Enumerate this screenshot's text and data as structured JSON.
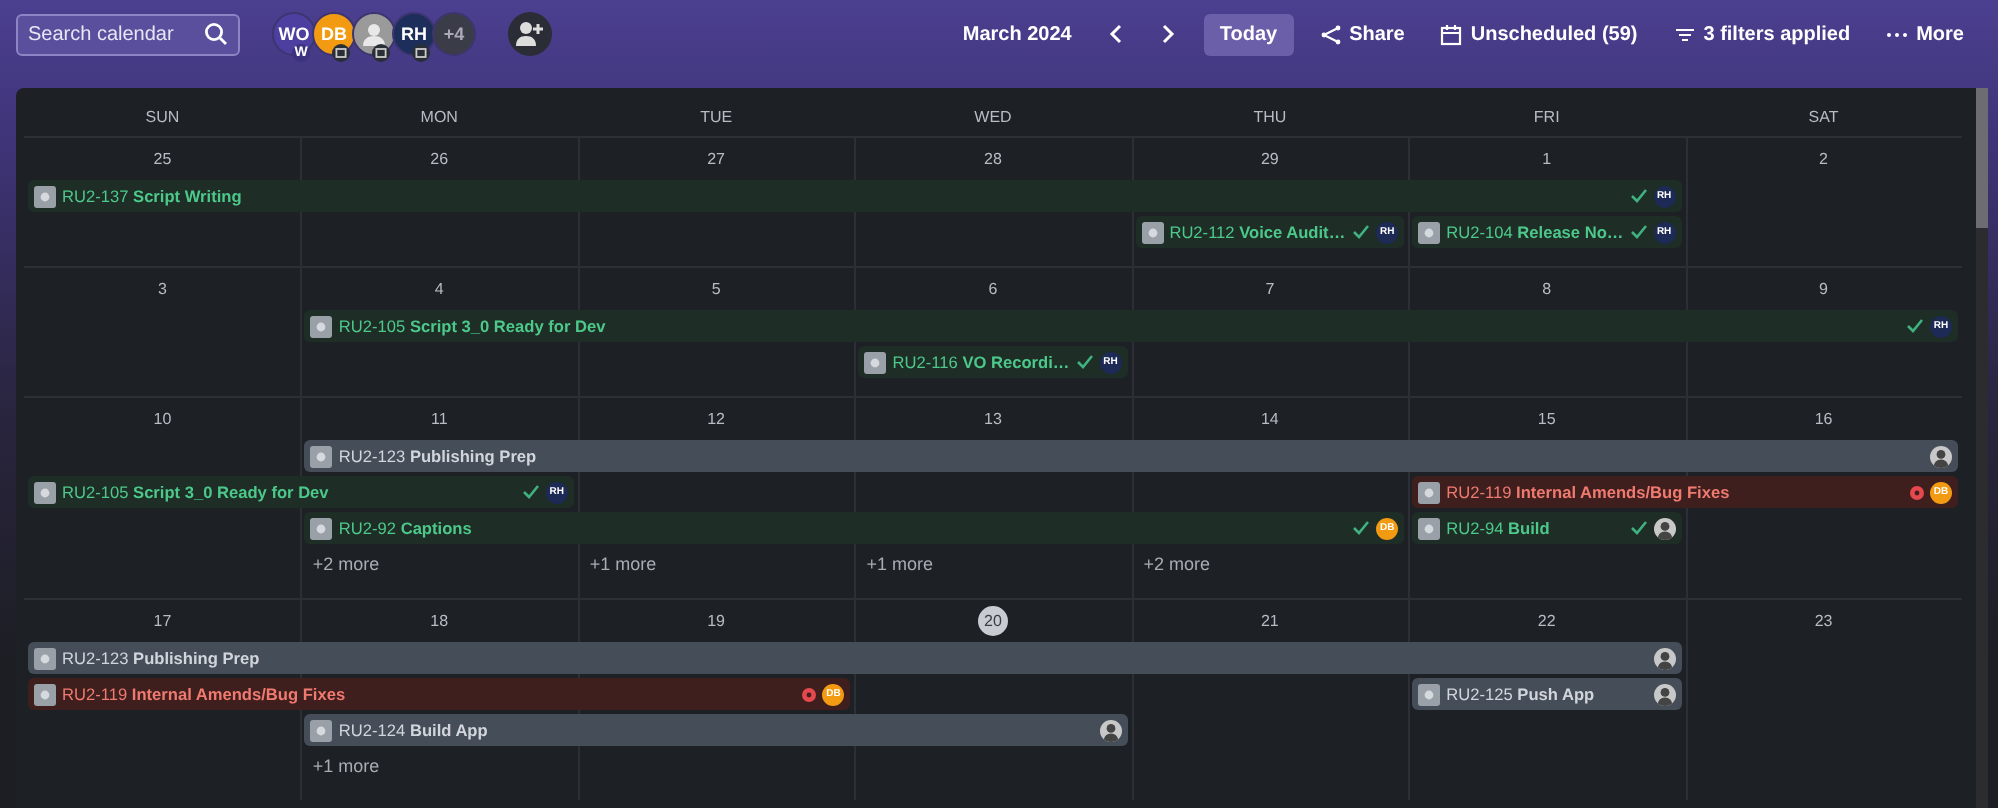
{
  "toolbar": {
    "search": {
      "placeholder": "Search calendar"
    },
    "avatars": [
      {
        "kind": "initials",
        "text": "WO",
        "color": "#4d3fa0",
        "badge": "W",
        "team_badge": false
      },
      {
        "kind": "initials",
        "text": "DB",
        "color": "#f29a12",
        "team_badge": true
      },
      {
        "kind": "photo",
        "team_badge": true
      },
      {
        "kind": "initials",
        "text": "RH",
        "color": "#1e2e5a",
        "team_badge": true
      },
      {
        "kind": "count",
        "text": "+4"
      }
    ],
    "month": "March 2024",
    "today": "Today",
    "share": "Share",
    "unscheduled": "Unscheduled (59)",
    "filters": "3 filters applied",
    "more": "More"
  },
  "weekdays": [
    "SUN",
    "MON",
    "TUE",
    "WED",
    "THU",
    "FRI",
    "SAT"
  ],
  "weeks": [
    {
      "days": [
        {
          "label": "25",
          "today": false
        },
        {
          "label": "26",
          "today": false
        },
        {
          "label": "27",
          "today": false
        },
        {
          "label": "28",
          "today": false
        },
        {
          "label": "29",
          "today": false
        },
        {
          "label": "1",
          "today": false
        },
        {
          "label": "2",
          "today": false
        }
      ],
      "lanes": [
        [
          {
            "kind": "done_event",
            "key": "RU2-137",
            "title": "Script Writing",
            "assignee": {
              "kind": "initials",
              "text": "RH",
              "color": "#1d2a55"
            }
          },
          {
            "kind": "continued"
          },
          {
            "kind": "continued"
          },
          {
            "kind": "continued"
          },
          {
            "kind": "continued"
          },
          {
            "kind": "continued"
          },
          {
            "kind": "empty"
          }
        ],
        [
          {
            "kind": "empty"
          },
          {
            "kind": "empty"
          },
          {
            "kind": "empty"
          },
          {
            "kind": "empty"
          },
          {
            "kind": "done_event",
            "key": "RU2-112",
            "title": "Voice Audit…",
            "assignee": {
              "kind": "initials",
              "text": "RH",
              "color": "#1d2a55"
            }
          },
          {
            "kind": "done_event",
            "key": "RU2-104",
            "title": "Release No…",
            "assignee": {
              "kind": "initials",
              "text": "RH",
              "color": "#1d2a55"
            }
          },
          {
            "kind": "empty"
          }
        ]
      ]
    },
    {
      "days": [
        {
          "label": "3",
          "today": false
        },
        {
          "label": "4",
          "today": false
        },
        {
          "label": "5",
          "today": false
        },
        {
          "label": "6",
          "today": false
        },
        {
          "label": "7",
          "today": false
        },
        {
          "label": "8",
          "today": false
        },
        {
          "label": "9",
          "today": false
        }
      ],
      "lanes": [
        [
          {
            "kind": "empty"
          },
          {
            "kind": "done_event",
            "key": "RU2-105",
            "title": "Script 3_0 Ready for Dev",
            "assignee": {
              "kind": "initials",
              "text": "RH",
              "color": "#1d2a55"
            }
          },
          {
            "kind": "continued"
          },
          {
            "kind": "continued"
          },
          {
            "kind": "continued"
          },
          {
            "kind": "continued"
          },
          {
            "kind": "continued"
          }
        ],
        [
          {
            "kind": "empty"
          },
          {
            "kind": "empty"
          },
          {
            "kind": "empty"
          },
          {
            "kind": "done_event",
            "key": "RU2-116",
            "title": "VO Recordi…",
            "assignee": {
              "kind": "initials",
              "text": "RH",
              "color": "#1d2a55"
            }
          },
          {
            "kind": "empty"
          },
          {
            "kind": "empty"
          },
          {
            "kind": "empty"
          }
        ]
      ]
    },
    {
      "days": [
        {
          "label": "10",
          "today": false
        },
        {
          "label": "11",
          "today": false
        },
        {
          "label": "12",
          "today": false
        },
        {
          "label": "13",
          "today": false
        },
        {
          "label": "14",
          "today": false
        },
        {
          "label": "15",
          "today": false
        },
        {
          "label": "16",
          "today": false
        }
      ],
      "lanes": [
        [
          {
            "kind": "empty"
          },
          {
            "kind": "open_event",
            "key": "RU2-123",
            "title": "Publishing Prep",
            "assignee": {
              "kind": "photo"
            }
          },
          {
            "kind": "continued"
          },
          {
            "kind": "continued"
          },
          {
            "kind": "continued"
          },
          {
            "kind": "continued"
          },
          {
            "kind": "continued"
          }
        ],
        [
          {
            "kind": "done_event",
            "key": "RU2-105",
            "title": "Script 3_0 Ready for Dev",
            "assignee": {
              "kind": "initials",
              "text": "RH",
              "color": "#1d2a55"
            }
          },
          {
            "kind": "continued"
          },
          {
            "kind": "empty"
          },
          {
            "kind": "empty"
          },
          {
            "kind": "empty"
          },
          {
            "kind": "blocked_event",
            "key": "RU2-119",
            "title": "Internal Amends/Bug Fixes",
            "assignee": {
              "kind": "initials",
              "text": "DB",
              "color": "#f29a12"
            }
          },
          {
            "kind": "continued"
          }
        ],
        [
          {
            "kind": "empty"
          },
          {
            "kind": "done_event",
            "key": "RU2-92",
            "title": "Captions",
            "assignee": {
              "kind": "initials",
              "text": "DB",
              "color": "#f29a12"
            }
          },
          {
            "kind": "continued"
          },
          {
            "kind": "continued"
          },
          {
            "kind": "continued"
          },
          {
            "kind": "done_event",
            "key": "RU2-94",
            "title": "Build",
            "assignee": {
              "kind": "photo"
            }
          },
          {
            "kind": "empty"
          }
        ],
        [
          {
            "kind": "empty"
          },
          {
            "kind": "more",
            "text": "+2 more"
          },
          {
            "kind": "more",
            "text": "+1 more"
          },
          {
            "kind": "more",
            "text": "+1 more"
          },
          {
            "kind": "more",
            "text": "+2 more"
          },
          {
            "kind": "empty"
          },
          {
            "kind": "empty"
          }
        ]
      ]
    },
    {
      "days": [
        {
          "label": "17",
          "today": false
        },
        {
          "label": "18",
          "today": false
        },
        {
          "label": "19",
          "today": false
        },
        {
          "label": "20",
          "today": true
        },
        {
          "label": "21",
          "today": false
        },
        {
          "label": "22",
          "today": false
        },
        {
          "label": "23",
          "today": false
        }
      ],
      "lanes": [
        [
          {
            "kind": "open_event",
            "key": "RU2-123",
            "title": "Publishing Prep",
            "assignee": {
              "kind": "photo"
            }
          },
          {
            "kind": "continued"
          },
          {
            "kind": "continued"
          },
          {
            "kind": "continued"
          },
          {
            "kind": "continued"
          },
          {
            "kind": "continued"
          },
          {
            "kind": "empty"
          }
        ],
        [
          {
            "kind": "blocked_event",
            "key": "RU2-119",
            "title": "Internal Amends/Bug Fixes",
            "assignee": {
              "kind": "initials",
              "text": "DB",
              "color": "#f29a12"
            }
          },
          {
            "kind": "continued"
          },
          {
            "kind": "continued"
          },
          {
            "kind": "empty"
          },
          {
            "kind": "empty"
          },
          {
            "kind": "open_event",
            "key": "RU2-125",
            "title": "Push App",
            "assignee": {
              "kind": "photo"
            }
          },
          {
            "kind": "empty"
          }
        ],
        [
          {
            "kind": "empty"
          },
          {
            "kind": "open_event",
            "key": "RU2-124",
            "title": "Build App",
            "assignee": {
              "kind": "photo"
            }
          },
          {
            "kind": "continued"
          },
          {
            "kind": "continued"
          },
          {
            "kind": "empty"
          },
          {
            "kind": "empty"
          },
          {
            "kind": "empty"
          }
        ],
        [
          {
            "kind": "empty"
          },
          {
            "kind": "more",
            "text": "+1 more"
          },
          {
            "kind": "empty"
          },
          {
            "kind": "empty"
          },
          {
            "kind": "empty"
          },
          {
            "kind": "empty"
          },
          {
            "kind": "empty"
          }
        ]
      ]
    }
  ]
}
